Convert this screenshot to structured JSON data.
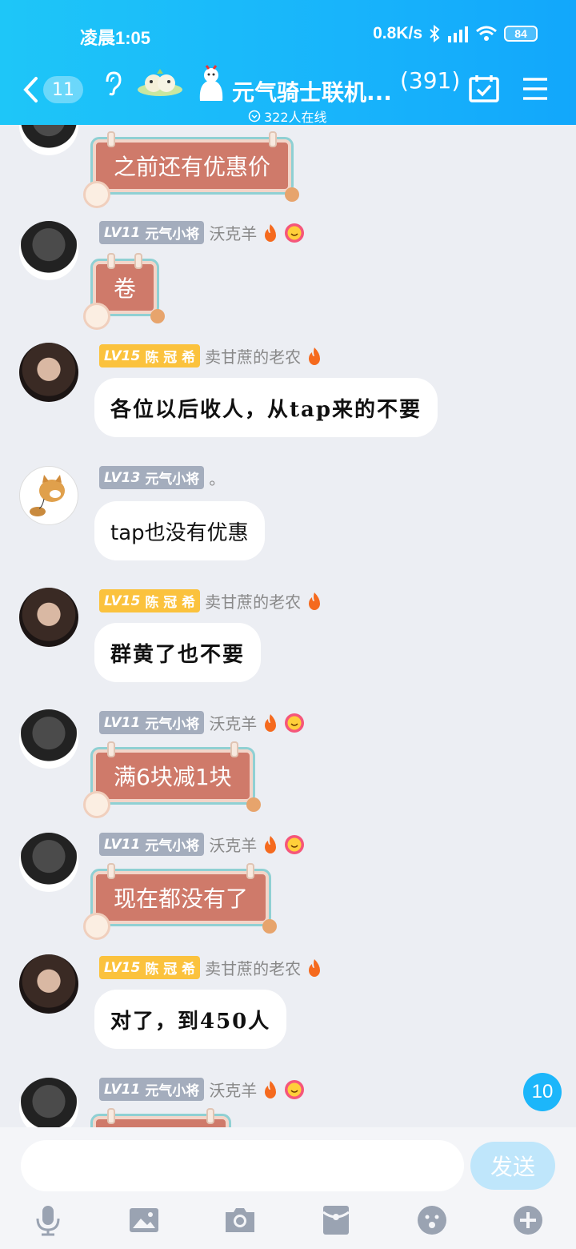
{
  "status_bar": {
    "time": "凌晨1:05",
    "speed": "0.8K/s",
    "battery": "84"
  },
  "header": {
    "back_count": "11",
    "title": "元气骑士联机...",
    "member_count": "(391)",
    "online": "322人在线"
  },
  "messages": [
    {
      "type": "sticker",
      "text": "之前还有优惠价"
    },
    {
      "type": "sticker",
      "level": "LV11",
      "role": "元气小将",
      "name": "沃克羊",
      "text": "卷"
    },
    {
      "type": "text",
      "level": "LV15",
      "role": "陈 冠 希",
      "name": "卖甘蔗的老农",
      "text": "各位以后收人，从tap来的不要"
    },
    {
      "type": "text",
      "level": "LV13",
      "role": "元气小将",
      "name": "。",
      "text": "tap也没有优惠"
    },
    {
      "type": "text",
      "level": "LV15",
      "role": "陈 冠 希",
      "name": "卖甘蔗的老农",
      "text": "群黄了也不要"
    },
    {
      "type": "sticker",
      "level": "LV11",
      "role": "元气小将",
      "name": "沃克羊",
      "text": "满6块减1块"
    },
    {
      "type": "sticker",
      "level": "LV11",
      "role": "元气小将",
      "name": "沃克羊",
      "text": "现在都没有了"
    },
    {
      "type": "text",
      "level": "LV15",
      "role": "陈 冠 希",
      "name": "卖甘蔗的老农",
      "text": "对了，到450人"
    },
    {
      "type": "sticker",
      "level": "LV11",
      "role": "元气小将",
      "name": "沃克羊",
      "text": ""
    }
  ],
  "unread_badge": "10",
  "input": {
    "placeholder": "",
    "send_label": "发送"
  },
  "toolbar_icons": [
    "mic-icon",
    "image-icon",
    "camera-icon",
    "red-packet-icon",
    "emoji-icon",
    "plus-icon"
  ],
  "colors": {
    "header": "#18b4fb",
    "accent": "#1cb6fa",
    "sticker": "#cf7a6a",
    "send_disabled": "#bfe6fb"
  }
}
